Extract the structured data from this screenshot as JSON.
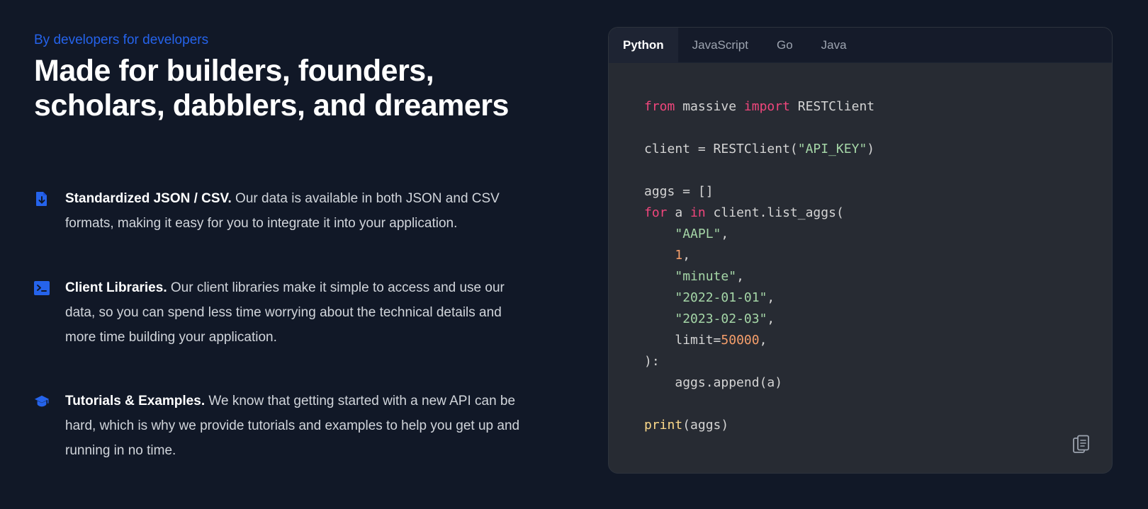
{
  "hero": {
    "eyebrow": "By developers for developers",
    "headline": "Made for builders, founders, scholars, dabblers, and dreamers"
  },
  "features": [
    {
      "icon": "file-download-icon",
      "title": "Standardized JSON / CSV.",
      "body": " Our data is available in both JSON and CSV formats, making it easy for you to integrate it into your application."
    },
    {
      "icon": "terminal-icon",
      "title": "Client Libraries.",
      "body": " Our client libraries make it simple to access and use our data, so you can spend less time worrying about the technical details and more time building your application."
    },
    {
      "icon": "graduation-cap-icon",
      "title": "Tutorials & Examples.",
      "body": " We know that getting started with a new API can be hard, which is why we provide tutorials and examples to help you get up and running in no time."
    }
  ],
  "code_panel": {
    "tabs": [
      "Python",
      "JavaScript",
      "Go",
      "Java"
    ],
    "active_tab": "Python",
    "copy_icon": "clipboard-copy-icon",
    "tokens": {
      "from": "from",
      "module": " massive ",
      "import": "import",
      "client_cls": " RESTClient",
      "client_assign": "client = RESTClient(",
      "api_key": "\"API_KEY\"",
      "close_paren": ")",
      "aggs_init": "aggs = []",
      "for": "for",
      "a": " a ",
      "in": "in",
      "call": " client.list_aggs(",
      "ticker": "\"AAPL\"",
      "multiplier": "1",
      "timespan": "\"minute\"",
      "from_date": "\"2022-01-01\"",
      "to_date": "\"2023-02-03\"",
      "limit_kw": "limit=",
      "limit_val": "50000",
      "close_call": "):",
      "append": "aggs.append(a)",
      "print": "print",
      "print_args": "(aggs)"
    }
  },
  "colors": {
    "background": "#111827",
    "accent": "#2563eb",
    "keyword": "#f0467c",
    "string": "#a5d6a7",
    "number": "#f59e6b",
    "builtin": "#fcd98a"
  }
}
